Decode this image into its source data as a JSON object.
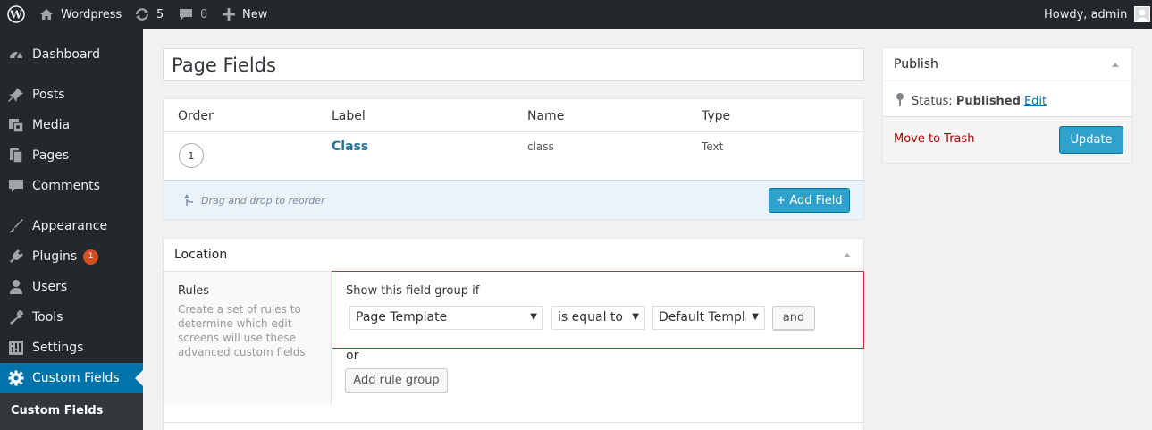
{
  "adminbar": {
    "site_name": "Wordpress",
    "updates_count": "5",
    "comments_count": "0",
    "new_label": "New",
    "howdy": "Howdy, admin"
  },
  "sidebar": {
    "items": [
      {
        "label": "Dashboard",
        "icon": "dashboard-icon"
      },
      {
        "label": "Posts",
        "icon": "pin-icon"
      },
      {
        "label": "Media",
        "icon": "media-icon"
      },
      {
        "label": "Pages",
        "icon": "pages-icon"
      },
      {
        "label": "Comments",
        "icon": "comment-icon"
      },
      {
        "label": "Appearance",
        "icon": "brush-icon"
      },
      {
        "label": "Plugins",
        "icon": "plug-icon",
        "badge": "1"
      },
      {
        "label": "Users",
        "icon": "user-icon"
      },
      {
        "label": "Tools",
        "icon": "wrench-icon"
      },
      {
        "label": "Settings",
        "icon": "settings-icon"
      },
      {
        "label": "Custom Fields",
        "icon": "gear-icon",
        "current": true
      }
    ],
    "submenu": [
      "Custom Fields"
    ]
  },
  "title": {
    "value": "Page Fields"
  },
  "fields_table": {
    "headers": [
      "Order",
      "Label",
      "Name",
      "Type"
    ],
    "rows": [
      {
        "order": "1",
        "label": "Class",
        "name": "class",
        "type": "Text"
      }
    ],
    "drag_hint": "Drag and drop to reorder",
    "add_field_label": "+ Add Field"
  },
  "location": {
    "title": "Location",
    "rules_title": "Rules",
    "rules_desc": "Create a set of rules to determine which edit screens will use these advanced custom fields",
    "group_title": "Show this field group if",
    "param_select": "Page Template",
    "operator_select": "is equal to",
    "value_select": "Default Template",
    "and_label": "and",
    "or_label": "or",
    "add_rule_group_label": "Add rule group"
  },
  "publish": {
    "title": "Publish",
    "status_label": "Status:",
    "status_value": "Published",
    "edit_label": "Edit",
    "trash_label": "Move to Trash",
    "update_label": "Update"
  },
  "colors": {
    "adminbar_bg": "#23282d",
    "menu_current": "#0073aa",
    "primary_button": "#2ea2cc",
    "badge": "#d54e21",
    "rule_border": "#c02f36",
    "trash_link": "#a00"
  }
}
